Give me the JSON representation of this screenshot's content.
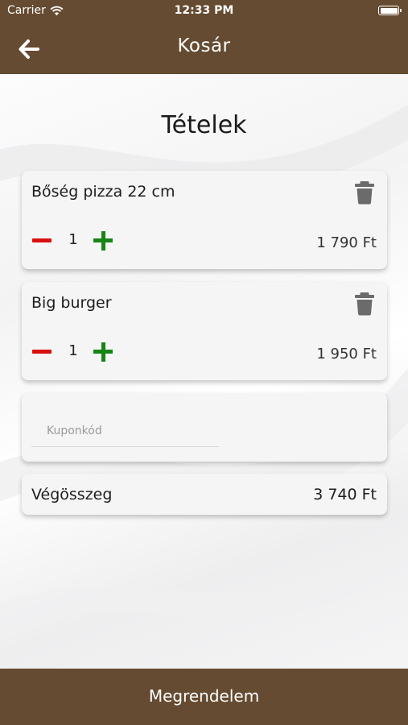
{
  "status_bar": {
    "carrier": "Carrier",
    "time": "12:33 PM"
  },
  "nav": {
    "title": "Kosár",
    "back_icon": "arrow-left-icon"
  },
  "section_title": "Tételek",
  "cart_items": [
    {
      "name": "Bőség pizza 22 cm",
      "quantity": "1",
      "price": "1 790 Ft"
    },
    {
      "name": "Big burger",
      "quantity": "1",
      "price": "1 950 Ft"
    }
  ],
  "coupon": {
    "placeholder": "Kuponkód",
    "value": ""
  },
  "total": {
    "label": "Végösszeg",
    "value": "3 740 Ft"
  },
  "order_button": {
    "label": "Megrendelem"
  },
  "colors": {
    "brand_brown": "#654b31",
    "minus_red": "#d90f0f",
    "plus_green": "#168516",
    "trash_gray": "#6b6b6b"
  }
}
